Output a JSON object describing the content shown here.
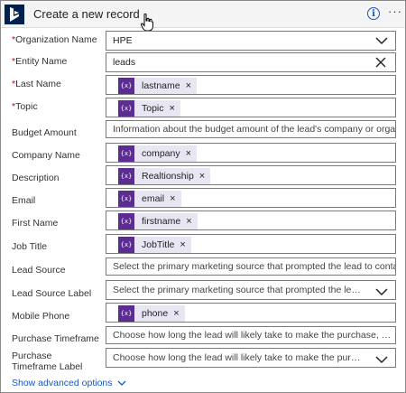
{
  "header": {
    "title": "Create a new record",
    "info_icon": "info-icon",
    "more_icon": "more-icon",
    "more_glyph": "···"
  },
  "fields": {
    "organization_name": {
      "label": "Organization Name",
      "required": true,
      "value": "HPE",
      "control": "dropdown"
    },
    "entity_name": {
      "label": "Entity Name",
      "required": true,
      "value": "leads",
      "control": "clearable"
    },
    "last_name": {
      "label": "Last Name",
      "required": true,
      "token": "lastname"
    },
    "topic": {
      "label": "Topic",
      "required": true,
      "token": "Topic"
    },
    "budget_amount": {
      "label": "Budget Amount",
      "placeholder": "Information about the budget amount of the lead's company or organization."
    },
    "company_name": {
      "label": "Company Name",
      "token": "company"
    },
    "description": {
      "label": "Description",
      "token": "Realtionship"
    },
    "email": {
      "label": "Email",
      "token": "email"
    },
    "first_name": {
      "label": "First Name",
      "token": "firstname"
    },
    "job_title": {
      "label": "Job Title",
      "token": "JobTitle"
    },
    "lead_source": {
      "label": "Lead Source",
      "placeholder": "Select the primary marketing source that prompted the lead to contact you."
    },
    "lead_source_label": {
      "label": "Lead Source Label",
      "placeholder": "Select the primary marketing source that prompted the lead to contac...",
      "control": "dropdown"
    },
    "mobile_phone": {
      "label": "Mobile Phone",
      "token": "phone"
    },
    "purchase_timeframe": {
      "label": "Purchase Timeframe",
      "placeholder": "Choose how long the lead will likely take to make the purchase, so the sales t..."
    },
    "purchase_timeframe_label": {
      "label": "Purchase Timeframe Label",
      "placeholder": "Choose how long the lead will likely take to make the purchase, so th...",
      "control": "dropdown"
    }
  },
  "required_marker": "*",
  "token_icon_glyph": "{x}",
  "token_remove_glyph": "×",
  "footer": {
    "advanced_label": "Show advanced options"
  },
  "colors": {
    "accent": "#1a55c0",
    "token_icon": "#5c2d91",
    "token_bg": "#e8e6f3",
    "required": "#cc0000",
    "logo": "#002050"
  }
}
